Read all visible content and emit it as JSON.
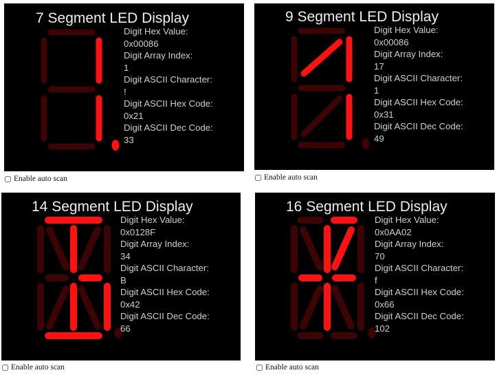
{
  "colors": {
    "on": "#ff1111",
    "off": "#3c0404",
    "panel": "#000000",
    "text": "#cfcfcf"
  },
  "panels": [
    {
      "title": "7 Segment LED Display",
      "type": 7,
      "lit": [
        "b",
        "c",
        "dp"
      ],
      "info": {
        "hex_label": "Digit Hex Value:",
        "hex_value": "0x00086",
        "index_label": "Digit Array Index:",
        "index_value": "1",
        "char_label": "Digit ASCII Character:",
        "char_value": "!",
        "ascii_hex_label": "Digit ASCII Hex Code:",
        "ascii_hex_value": "0x21",
        "ascii_dec_label": "Digit ASCII Dec Code:",
        "ascii_dec_value": "33"
      },
      "autoscan_label": "Enable auto scan"
    },
    {
      "title": "9 Segment LED Display",
      "type": 9,
      "lit": [
        "b",
        "c",
        "diag_bl_up"
      ],
      "info": {
        "hex_label": "Digit Hex Value:",
        "hex_value": "0x00086",
        "index_label": "Digit Array Index:",
        "index_value": "17",
        "char_label": "Digit ASCII Character:",
        "char_value": "1",
        "ascii_hex_label": "Digit ASCII Hex Code:",
        "ascii_hex_value": "0x31",
        "ascii_dec_label": "Digit ASCII Dec Code:",
        "ascii_dec_value": "49"
      },
      "autoscan_label": "Enable auto scan"
    },
    {
      "title": "14 Segment LED Display",
      "type": 14,
      "lit": [
        "a",
        "d",
        "m_top",
        "m_bot",
        "g2",
        "b_lower_right",
        "c"
      ],
      "info": {
        "hex_label": "Digit Hex Value:",
        "hex_value": "0x0128F",
        "index_label": "Digit Array Index:",
        "index_value": "34",
        "char_label": "Digit ASCII Character:",
        "char_value": "B",
        "ascii_hex_label": "Digit ASCII Hex Code:",
        "ascii_hex_value": "0x42",
        "ascii_dec_label": "Digit ASCII Dec Code:",
        "ascii_dec_value": "66"
      },
      "autoscan_label": "Enable auto scan"
    },
    {
      "title": "16 Segment LED Display",
      "type": 16,
      "lit": [
        "a2",
        "m_top",
        "m_bot",
        "g1",
        "g2",
        "diag_tr"
      ],
      "info": {
        "hex_label": "Digit Hex Value:",
        "hex_value": "0x0AA02",
        "index_label": "Digit Array Index:",
        "index_value": "70",
        "char_label": "Digit ASCII Character:",
        "char_value": "f",
        "ascii_hex_label": "Digit ASCII Hex Code:",
        "ascii_hex_value": "0x66",
        "ascii_dec_label": "Digit ASCII Dec Code:",
        "ascii_dec_value": "102"
      },
      "autoscan_label": "Enable auto scan"
    }
  ]
}
